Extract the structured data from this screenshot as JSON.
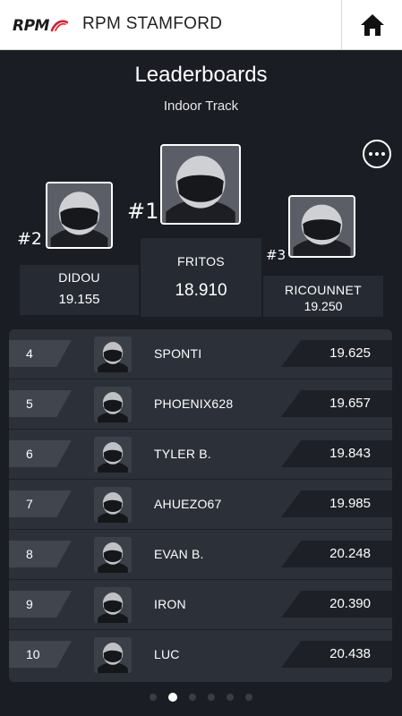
{
  "header": {
    "logo_text": "RPM",
    "site_name": "RPM STAMFORD",
    "home_icon": "home-icon"
  },
  "page": {
    "title": "Leaderboards",
    "subtitle": "Indoor Track",
    "more_icon": "more-options-icon"
  },
  "podium": {
    "first": {
      "rank": "#1",
      "name": "FRITOS",
      "time": "18.910"
    },
    "second": {
      "rank": "#2",
      "name": "DIDOU",
      "time": "19.155"
    },
    "third": {
      "rank": "#3",
      "name": "RICOUNNET",
      "time": "19.250"
    }
  },
  "rows": [
    {
      "rank": "4",
      "name": "SPONTI",
      "time": "19.625"
    },
    {
      "rank": "5",
      "name": "PHOENIX628",
      "time": "19.657"
    },
    {
      "rank": "6",
      "name": "TYLER B.",
      "time": "19.843"
    },
    {
      "rank": "7",
      "name": "AHUEZO67",
      "time": "19.985"
    },
    {
      "rank": "8",
      "name": "EVAN B.",
      "time": "20.248"
    },
    {
      "rank": "9",
      "name": "IRON",
      "time": "20.390"
    },
    {
      "rank": "10",
      "name": "LUC",
      "time": "20.438"
    }
  ],
  "pagination": {
    "count": 6,
    "active_index": 1
  },
  "colors": {
    "background": "#1b1d24",
    "brand_red": "#e31d2b",
    "list_background": "#2c3039"
  }
}
